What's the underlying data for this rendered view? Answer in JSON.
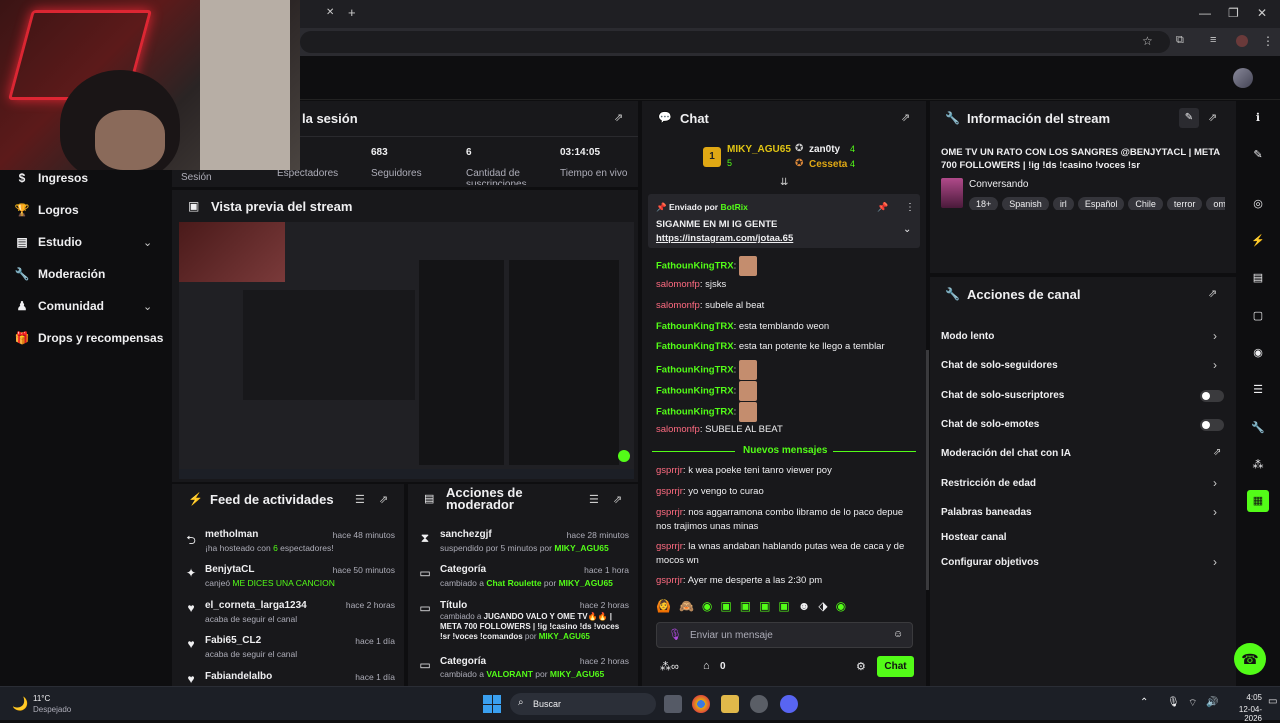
{
  "browser": {
    "new_tab_symbol": "+",
    "close_tab_symbol": "✕"
  },
  "sidebar": {
    "items": [
      {
        "label": "Ingresos",
        "icon": "dollar-icon"
      },
      {
        "label": "Logros",
        "icon": "trophy-icon"
      },
      {
        "label": "Estudio",
        "icon": "studio-icon",
        "has_chevron": true
      },
      {
        "label": "Moderación",
        "icon": "wrench-icon"
      },
      {
        "label": "Comunidad",
        "icon": "community-icon",
        "has_chevron": true
      },
      {
        "label": "Drops y recompensas",
        "icon": "gift-icon"
      }
    ]
  },
  "session": {
    "title_fragment": "la sesión",
    "first_label": "Sesión",
    "stats": [
      {
        "value": "",
        "label": "Espectadores"
      },
      {
        "value": "683",
        "label": "Seguidores"
      },
      {
        "value": "6",
        "label": "Cantidad de suscripciones"
      },
      {
        "value": "03:14:05",
        "label": "Tiempo en vivo"
      }
    ]
  },
  "preview": {
    "title": "Vista previa del stream"
  },
  "activity_feed": {
    "title": "Feed de actividades",
    "items": [
      {
        "name": "metholman",
        "time": "hace 48 minutos",
        "sub_prefix": "¡ha hosteado con ",
        "sub_highlight": "6",
        "sub_suffix": " espectadores!",
        "icon": "host-icon"
      },
      {
        "name": "BenjytaCL",
        "time": "hace 50 minutos",
        "sub_prefix": "canjeó ",
        "sub_highlight": "ME DICES UNA CANCION",
        "sub_suffix": "",
        "icon": "redeem-icon"
      },
      {
        "name": "el_corneta_larga1234",
        "time": "hace 2 horas",
        "sub_prefix": "acaba de seguir el canal",
        "sub_highlight": "",
        "sub_suffix": "",
        "icon": "heart-icon"
      },
      {
        "name": "Fabi65_CL2",
        "time": "hace 1 día",
        "sub_prefix": "acaba de seguir el canal",
        "sub_highlight": "",
        "sub_suffix": "",
        "icon": "heart-icon"
      },
      {
        "name": "Fabiandelalbo",
        "time": "hace 1 día",
        "sub_prefix": "",
        "sub_highlight": "",
        "sub_suffix": "",
        "icon": "heart-icon"
      }
    ]
  },
  "mod_actions": {
    "title_line1": "Acciones de",
    "title_line2": "moderador",
    "items": [
      {
        "name": "sanchezgjf",
        "time": "hace 28 minutos",
        "line1": "suspendido por 5 minutos por ",
        "by": "MIKY_AGU65",
        "icon": "hourglass-icon"
      },
      {
        "name": "Categoría",
        "time": "hace 1 hora",
        "line1": "cambiado a ",
        "hl": "Chat Roulette",
        "mid": " por ",
        "by": "MIKY_AGU65",
        "icon": "category-icon"
      },
      {
        "name": "Título",
        "time": "hace 2 horas",
        "line1": "cambiado a ",
        "hl": "JUGANDO VALO Y OME TV🔥🔥 | META 700 FOLLOWERS | !ig !casino !ds !voces !sr !voces !comandos",
        "mid": " por ",
        "by": "MIKY_AGU65",
        "icon": "title-icon"
      },
      {
        "name": "Categoría",
        "time": "hace 2 horas",
        "line1": "cambiado a ",
        "hl": "VALORANT",
        "mid": " por ",
        "by": "MIKY_AGU65",
        "icon": "category-icon"
      }
    ]
  },
  "chat": {
    "title": "Chat",
    "top_gifters": [
      {
        "name": "MIKY_AGU65",
        "count": "5",
        "rank": "1"
      },
      {
        "name": "zan0ty",
        "count": "4"
      },
      {
        "name": "Cesseta",
        "count": "4"
      }
    ],
    "pinned": {
      "sent_by_label": "Enviado por",
      "sender": "BotRix",
      "text": "SIGANME EN MI IG GENTE",
      "link": "https://instagram.com/jotaa.65"
    },
    "messages": [
      {
        "user": "FathounKingTRX",
        "color": "green",
        "text": "",
        "emotes": 1
      },
      {
        "user": "salomonfp",
        "color": "red",
        "text": "sjsks",
        "emotes": 0
      },
      {
        "user": "salomonfp",
        "color": "red",
        "text": "subele al beat",
        "emotes": 0
      },
      {
        "user": "FathounKingTRX",
        "color": "green",
        "text": "esta temblando weon",
        "emotes": 0
      },
      {
        "user": "FathounKingTRX",
        "color": "green",
        "text": "esta tan potente ke llego a temblar",
        "emotes": 0
      },
      {
        "user": "FathounKingTRX",
        "color": "green",
        "text": "",
        "emotes": 1
      },
      {
        "user": "FathounKingTRX",
        "color": "green",
        "text": "",
        "emotes": 1
      },
      {
        "user": "FathounKingTRX",
        "color": "green",
        "text": "",
        "emotes": 1
      },
      {
        "user": "salomonfp",
        "color": "red",
        "text": "SUBELE AL BEAT",
        "emotes": 0
      }
    ],
    "new_messages_label": "Nuevos mensajes",
    "new_messages": [
      {
        "user": "gsprrjr",
        "text": "k wea poeke teni tanro viewer poy"
      },
      {
        "user": "gsprrjr",
        "text": "yo vengo to curao"
      },
      {
        "user": "gsprrjr",
        "text": "nos aggarramona combo libramo de lo paco depue nos trajimos unas minas"
      },
      {
        "user": "gsprrjr",
        "text": "la wnas andaban hablando putas wea de caca y de mocos wn"
      },
      {
        "user": "gsprrjr",
        "text": "Ayer me desperte a las 2:30 pm"
      }
    ],
    "input_placeholder": "Enviar un mensaje",
    "points": "0",
    "chat_button": "Chat"
  },
  "stream_info": {
    "title": "Información del stream",
    "stream_title": "OME TV UN RATO CON LOS SANGRES @BENJYTACL | META 700 FOLLOWERS | !ig !ds !casino !voces !sr",
    "category": "Conversando",
    "tags": [
      "18+",
      "Spanish",
      "irl",
      "Español",
      "Chile",
      "terror",
      "om"
    ]
  },
  "channel_actions": {
    "title": "Acciones de canal",
    "rows": [
      {
        "label": "Modo lento",
        "control": "chevron"
      },
      {
        "label": "Chat de solo-seguidores",
        "control": "chevron"
      },
      {
        "label": "Chat de solo-suscriptores",
        "control": "toggle"
      },
      {
        "label": "Chat de solo-emotes",
        "control": "toggle"
      },
      {
        "label": "Moderación del chat con IA",
        "control": "external"
      },
      {
        "label": "Restricción de edad",
        "control": "chevron"
      },
      {
        "label": "Palabras baneadas",
        "control": "chevron"
      },
      {
        "label": "Hostear canal",
        "control": "none"
      },
      {
        "label": "Configurar objetivos",
        "control": "chevron"
      }
    ]
  },
  "taskbar": {
    "weather_temp": "11°C",
    "weather_desc": "Despejado",
    "search_placeholder": "Buscar",
    "time": "4:05",
    "date": "12-04-2026"
  },
  "colors": {
    "accent": "#53fc18",
    "panel": "#18181b",
    "background": "#0e0e10",
    "username_red": "#ff6b81"
  }
}
